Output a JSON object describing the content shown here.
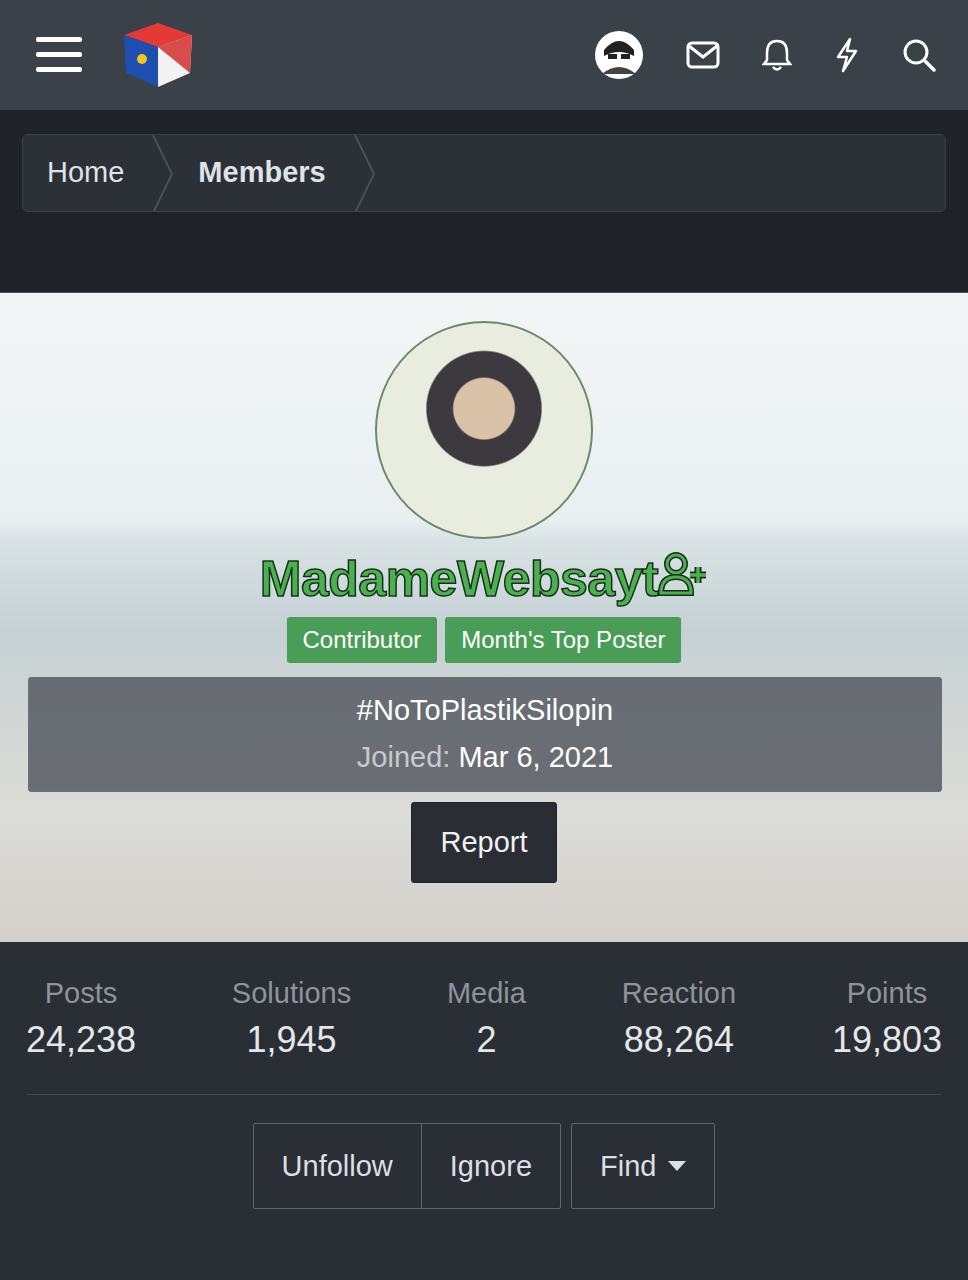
{
  "breadcrumb": [
    {
      "label": "Home",
      "selected": false
    },
    {
      "label": "Members",
      "selected": true
    }
  ],
  "profile": {
    "username": "MadameWebsayt",
    "badges": [
      "Contributor",
      "Month's Top Poster"
    ],
    "status": "#NoToPlastikSilopin",
    "joined_label": "Joined:",
    "joined_date": "Mar 6, 2021",
    "report": "Report"
  },
  "stats": [
    {
      "label": "Posts",
      "value": "24,238"
    },
    {
      "label": "Solutions",
      "value": "1,945"
    },
    {
      "label": "Media",
      "value": "2"
    },
    {
      "label": "Reaction",
      "value": "88,264"
    },
    {
      "label": "Points",
      "value": "19,803"
    }
  ],
  "actions": [
    "Unfollow",
    "Ignore"
  ],
  "find": "Find"
}
